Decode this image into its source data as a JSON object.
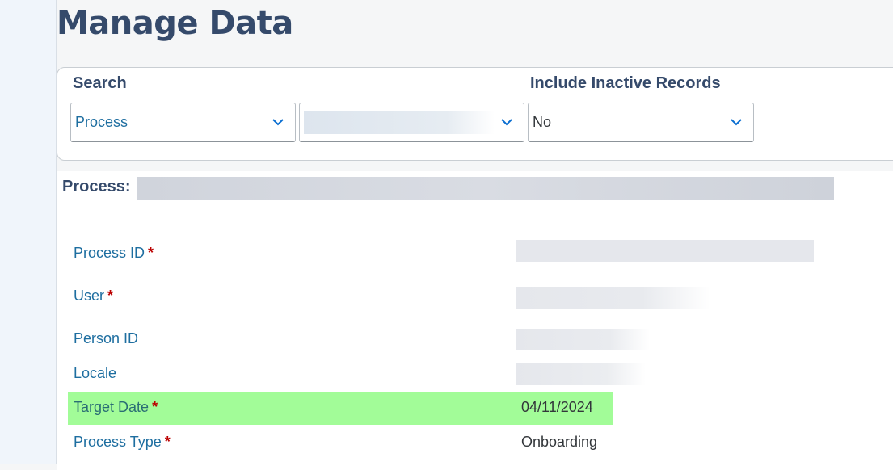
{
  "page": {
    "title": "Manage Data"
  },
  "search": {
    "label": "Search",
    "category_select": {
      "value": "Process"
    },
    "inactive_label": "Include Inactive Records",
    "inactive_select": {
      "value": "No"
    }
  },
  "details": {
    "heading_label": "Process:",
    "fields": [
      {
        "label": "Process ID",
        "required_mark": "*"
      },
      {
        "label": "User",
        "required_mark": "*"
      },
      {
        "label": "Person ID"
      },
      {
        "label": "Locale"
      },
      {
        "label": "Target Date",
        "required_mark": "*",
        "value": "04/11/2024"
      },
      {
        "label": "Process Type",
        "required_mark": "*",
        "value": "Onboarding"
      }
    ],
    "highlight_color": "#a2fc98"
  },
  "colors": {
    "title": "#354a6b",
    "field_label": "#1e6ea0",
    "required": "#bb0000",
    "chevron": "#0a6ed1"
  }
}
